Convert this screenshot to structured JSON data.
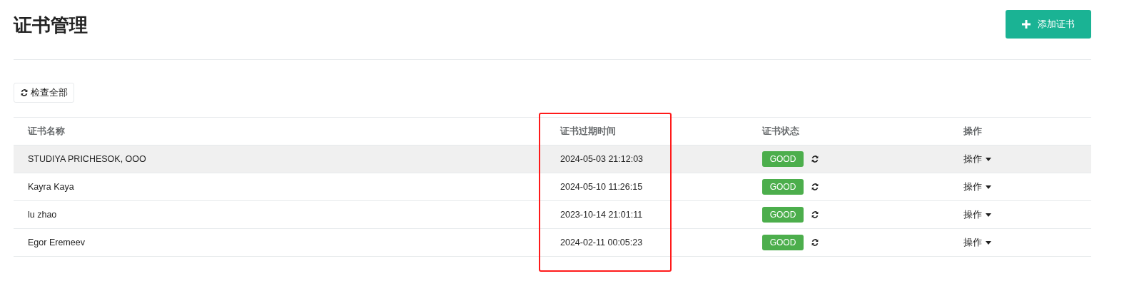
{
  "page": {
    "title": "证书管理"
  },
  "add_button": {
    "label": "添加证书"
  },
  "check_all_button": {
    "label": "检查全部"
  },
  "table": {
    "columns": [
      {
        "label": "证书名称",
        "highlighted": false
      },
      {
        "label": "证书过期时间",
        "highlighted": true
      },
      {
        "label": "证书状态",
        "highlighted": false
      },
      {
        "label": "操作",
        "highlighted": false
      }
    ],
    "rows": [
      {
        "name": "STUDIYA PRICHESOK, OOO",
        "expires": "2024-05-03 21:12:03",
        "status": {
          "label": "GOOD",
          "color": "#4cae4c"
        },
        "action": "操作",
        "highlighted": true
      },
      {
        "name": "Kayra Kaya",
        "expires": "2024-05-10 11:26:15",
        "status": {
          "label": "GOOD",
          "color": "#4cae4c"
        },
        "action": "操作",
        "highlighted": false
      },
      {
        "name": "lu zhao",
        "expires": "2023-10-14 21:01:11",
        "status": {
          "label": "GOOD",
          "color": "#4cae4c"
        },
        "action": "操作",
        "highlighted": false
      },
      {
        "name": "Egor Eremeev",
        "expires": "2024-02-11 00:05:23",
        "status": {
          "label": "GOOD",
          "color": "#4cae4c"
        },
        "action": "操作",
        "highlighted": false
      }
    ]
  }
}
